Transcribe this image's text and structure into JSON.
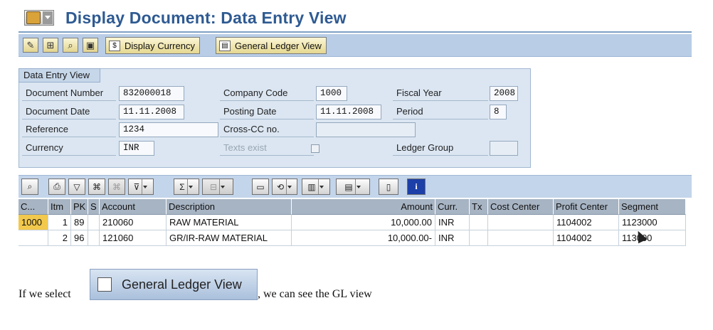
{
  "title": "Display Document: Data Entry View",
  "toolbar": {
    "display_currency": "Display Currency",
    "general_ledger_view": "General Ledger View"
  },
  "panel": {
    "tab_label": "Data Entry View",
    "document_number_label": "Document Number",
    "document_number": "832000018",
    "company_code_label": "Company Code",
    "company_code": "1000",
    "fiscal_year_label": "Fiscal Year",
    "fiscal_year": "2008",
    "document_date_label": "Document Date",
    "document_date": "11.11.2008",
    "posting_date_label": "Posting Date",
    "posting_date": "11.11.2008",
    "period_label": "Period",
    "period": "8",
    "reference_label": "Reference",
    "reference": "1234",
    "cross_cc_label": "Cross-CC no.",
    "currency_label": "Currency",
    "currency": "INR",
    "texts_exist_label": "Texts exist",
    "ledger_group_label": "Ledger Group"
  },
  "table": {
    "columns": [
      "C...",
      "Itm",
      "PK",
      "S",
      "Account",
      "Description",
      "Amount",
      "Curr.",
      "Tx",
      "Cost Center",
      "Profit Center",
      "Segment"
    ],
    "rows": [
      [
        "1000",
        "1",
        "89",
        "",
        "210060",
        "RAW MATERIAL",
        "10,000.00",
        "INR",
        "",
        "",
        "1104002",
        "1123000"
      ],
      [
        "",
        "2",
        "96",
        "",
        "121060",
        "GR/IR-RAW MATERIAL",
        "10,000.00-",
        "INR",
        "",
        "",
        "1104002",
        "11​3000"
      ]
    ]
  },
  "caption": {
    "before": "If we select",
    "button_label": "General Ledger View",
    "after": ", we can see the GL view"
  }
}
